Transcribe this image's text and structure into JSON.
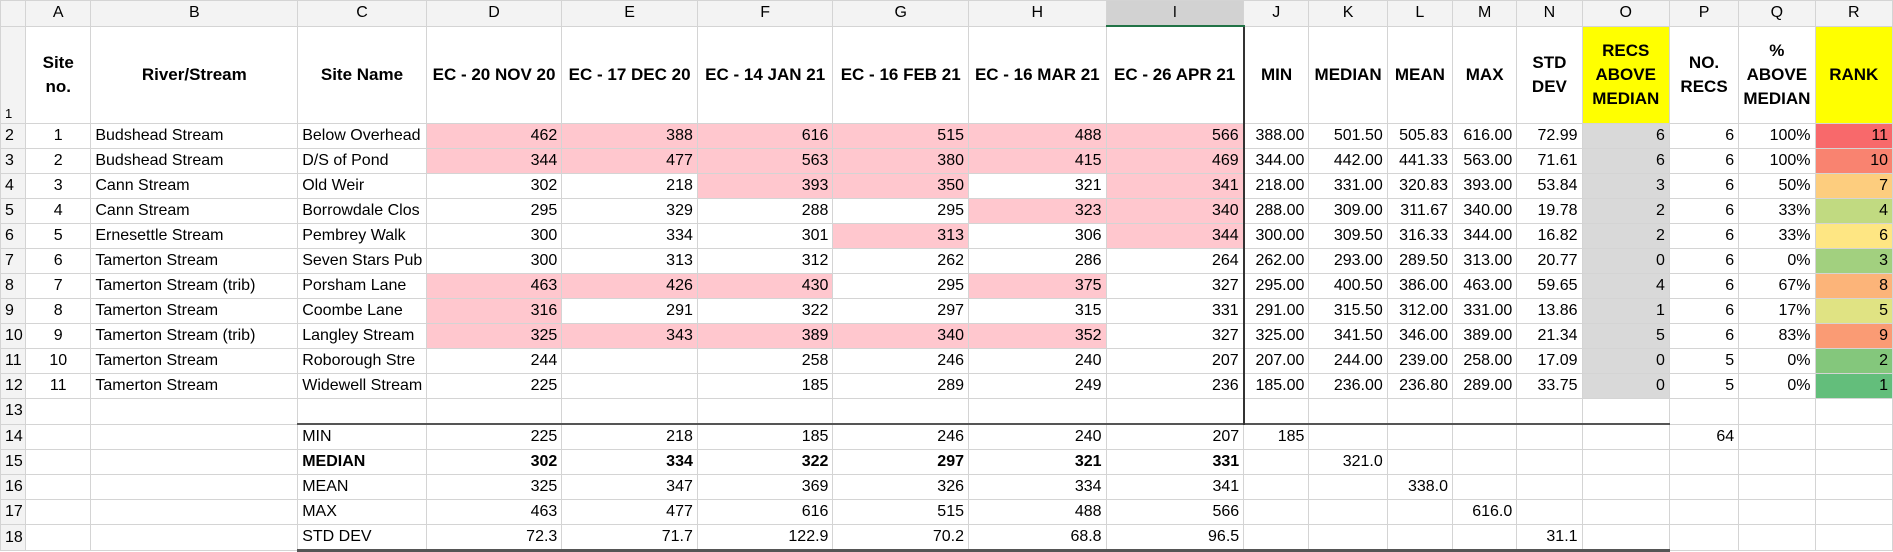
{
  "columns": [
    "A",
    "B",
    "C",
    "D",
    "E",
    "F",
    "G",
    "H",
    "I",
    "J",
    "K",
    "L",
    "M",
    "N",
    "O",
    "P",
    "Q",
    "R"
  ],
  "headers": {
    "site_no": "Site no.",
    "river": "River/Stream",
    "site_name": "Site Name",
    "ec1": "EC - 20 NOV 20",
    "ec2": "EC - 17 DEC 20",
    "ec3": "EC - 14 JAN 21",
    "ec4": "EC - 16 FEB 21",
    "ec5": "EC - 16 MAR 21",
    "ec6": "EC - 26 APR 21",
    "min": "MIN",
    "median": "MEDIAN",
    "mean": "MEAN",
    "max": "MAX",
    "std": "STD DEV",
    "recs_above": "RECS ABOVE MEDIAN",
    "no_recs": "NO. RECS",
    "pct_above": "% ABOVE MEDIAN",
    "rank": "RANK"
  },
  "rows": [
    {
      "rn": "2",
      "site": "1",
      "river": "Budshead Stream",
      "name": "Below Overhead",
      "ec": [
        "462",
        "388",
        "616",
        "515",
        "488",
        "566"
      ],
      "pink": [
        1,
        1,
        1,
        1,
        1,
        1
      ],
      "min": "388.00",
      "median": "501.50",
      "mean": "505.83",
      "max": "616.00",
      "std": "72.99",
      "recs": "6",
      "no": "6",
      "pct": "100%",
      "rank": "11",
      "rank_color": "#f8696b"
    },
    {
      "rn": "3",
      "site": "2",
      "river": "Budshead Stream",
      "name": "D/S of Pond",
      "ec": [
        "344",
        "477",
        "563",
        "380",
        "415",
        "469"
      ],
      "pink": [
        1,
        1,
        1,
        1,
        1,
        1
      ],
      "min": "344.00",
      "median": "442.00",
      "mean": "441.33",
      "max": "563.00",
      "std": "71.61",
      "recs": "6",
      "no": "6",
      "pct": "100%",
      "rank": "10",
      "rank_color": "#f98370"
    },
    {
      "rn": "4",
      "site": "3",
      "river": "Cann Stream",
      "name": "Old Weir",
      "ec": [
        "302",
        "218",
        "393",
        "350",
        "321",
        "341"
      ],
      "pink": [
        0,
        0,
        1,
        1,
        0,
        1
      ],
      "min": "218.00",
      "median": "331.00",
      "mean": "320.83",
      "max": "393.00",
      "std": "53.84",
      "recs": "3",
      "no": "6",
      "pct": "50%",
      "rank": "7",
      "rank_color": "#fdcd7e"
    },
    {
      "rn": "5",
      "site": "4",
      "river": "Cann Stream",
      "name": "Borrowdale Clos",
      "ec": [
        "295",
        "329",
        "288",
        "295",
        "323",
        "340"
      ],
      "pink": [
        0,
        0,
        0,
        0,
        1,
        1
      ],
      "min": "288.00",
      "median": "309.00",
      "mean": "311.67",
      "max": "340.00",
      "std": "19.78",
      "recs": "2",
      "no": "6",
      "pct": "33%",
      "rank": "4",
      "rank_color": "#c1da81"
    },
    {
      "rn": "6",
      "site": "5",
      "river": "Ernesettle Stream",
      "name": "Pembrey Walk",
      "ec": [
        "300",
        "334",
        "301",
        "313",
        "306",
        "344"
      ],
      "pink": [
        0,
        0,
        0,
        1,
        0,
        1
      ],
      "min": "300.00",
      "median": "309.50",
      "mean": "316.33",
      "max": "344.00",
      "std": "16.82",
      "recs": "2",
      "no": "6",
      "pct": "33%",
      "rank": "6",
      "rank_color": "#fee683"
    },
    {
      "rn": "7",
      "site": "6",
      "river": "Tamerton Stream",
      "name": "Seven Stars Pub",
      "ec": [
        "300",
        "313",
        "312",
        "262",
        "286",
        "264"
      ],
      "pink": [
        0,
        0,
        0,
        0,
        0,
        0
      ],
      "min": "262.00",
      "median": "293.00",
      "mean": "289.50",
      "max": "313.00",
      "std": "20.77",
      "recs": "0",
      "no": "6",
      "pct": "0%",
      "rank": "3",
      "rank_color": "#a2d07f"
    },
    {
      "rn": "8",
      "site": "7",
      "river": "Tamerton Stream (trib)",
      "name": "Porsham Lane",
      "ec": [
        "463",
        "426",
        "430",
        "295",
        "375",
        "327"
      ],
      "pink": [
        1,
        1,
        1,
        0,
        1,
        0
      ],
      "min": "295.00",
      "median": "400.50",
      "mean": "386.00",
      "max": "463.00",
      "std": "59.65",
      "recs": "4",
      "no": "6",
      "pct": "67%",
      "rank": "8",
      "rank_color": "#fcb479"
    },
    {
      "rn": "9",
      "site": "8",
      "river": "Tamerton Stream",
      "name": "Coombe Lane",
      "ec": [
        "316",
        "291",
        "322",
        "297",
        "315",
        "331"
      ],
      "pink": [
        1,
        0,
        0,
        0,
        0,
        0
      ],
      "min": "291.00",
      "median": "315.50",
      "mean": "312.00",
      "max": "331.00",
      "std": "13.86",
      "recs": "1",
      "no": "6",
      "pct": "17%",
      "rank": "5",
      "rank_color": "#e0e383"
    },
    {
      "rn": "10",
      "site": "9",
      "river": "Tamerton Stream (trib)",
      "name": "Langley Stream",
      "ec": [
        "325",
        "343",
        "389",
        "340",
        "352",
        "327"
      ],
      "pink": [
        1,
        1,
        1,
        1,
        1,
        0
      ],
      "min": "325.00",
      "median": "341.50",
      "mean": "346.00",
      "max": "389.00",
      "std": "21.34",
      "recs": "5",
      "no": "6",
      "pct": "83%",
      "rank": "9",
      "rank_color": "#fa9b74"
    },
    {
      "rn": "11",
      "site": "10",
      "river": "Tamerton Stream",
      "name": "Roborough Stre",
      "ec": [
        "244",
        "",
        "258",
        "246",
        "240",
        "207"
      ],
      "pink": [
        0,
        0,
        0,
        0,
        0,
        0
      ],
      "min": "207.00",
      "median": "244.00",
      "mean": "239.00",
      "max": "258.00",
      "std": "17.09",
      "recs": "0",
      "no": "5",
      "pct": "0%",
      "rank": "2",
      "rank_color": "#84c77c"
    },
    {
      "rn": "12",
      "site": "11",
      "river": "Tamerton Stream",
      "name": "Widewell Stream",
      "ec": [
        "225",
        "",
        "185",
        "289",
        "249",
        "236"
      ],
      "pink": [
        0,
        0,
        0,
        0,
        0,
        0
      ],
      "min": "185.00",
      "median": "236.00",
      "mean": "236.80",
      "max": "289.00",
      "std": "33.75",
      "recs": "0",
      "no": "5",
      "pct": "0%",
      "rank": "1",
      "rank_color": "#63be7b"
    }
  ],
  "summary": [
    {
      "rn": "14",
      "label": "MIN",
      "vals": [
        "225",
        "218",
        "185",
        "246",
        "240",
        "207"
      ],
      "bold": false,
      "j": "185",
      "k": "",
      "l": "",
      "m": "",
      "n": "",
      "p": "64"
    },
    {
      "rn": "15",
      "label": "MEDIAN",
      "vals": [
        "302",
        "334",
        "322",
        "297",
        "321",
        "331"
      ],
      "bold": true,
      "j": "",
      "k": "321.0",
      "l": "",
      "m": "",
      "n": "",
      "p": ""
    },
    {
      "rn": "16",
      "label": "MEAN",
      "vals": [
        "325",
        "347",
        "369",
        "326",
        "334",
        "341"
      ],
      "bold": false,
      "j": "",
      "k": "",
      "l": "338.0",
      "m": "",
      "n": "",
      "p": ""
    },
    {
      "rn": "17",
      "label": "MAX",
      "vals": [
        "463",
        "477",
        "616",
        "515",
        "488",
        "566"
      ],
      "bold": false,
      "j": "",
      "k": "",
      "l": "",
      "m": "616.0",
      "n": "",
      "p": ""
    },
    {
      "rn": "18",
      "label": "STD DEV",
      "vals": [
        "72.3",
        "71.7",
        "122.9",
        "70.2",
        "68.8",
        "96.5"
      ],
      "bold": false,
      "j": "",
      "k": "",
      "l": "",
      "m": "",
      "n": "31.1",
      "p": ""
    }
  ],
  "row_numbers": {
    "header": "1",
    "blank": "13"
  },
  "colors": {
    "highlight_pink": "#ffc7ce",
    "highlight_text": "#9c0006",
    "yellow": "#ffff00",
    "grey": "#d9d9d9",
    "recs_header_text": "#c00000"
  }
}
